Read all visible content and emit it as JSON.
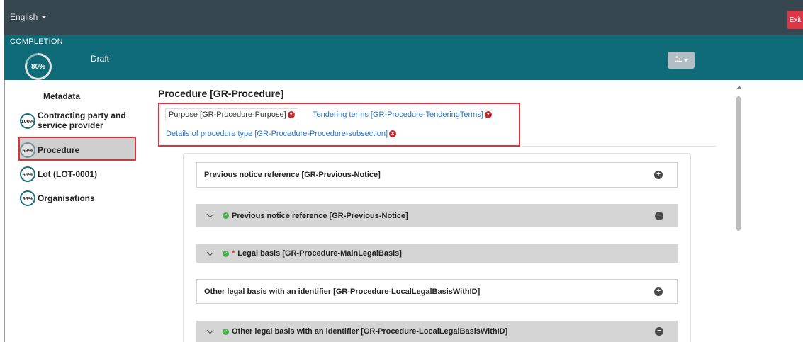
{
  "topbar": {
    "language": "English",
    "exit_label": "Exit"
  },
  "completion": {
    "title": "COMPLETION",
    "percent": "80%",
    "status": "Draft"
  },
  "sidebar": {
    "heading": "Metadata",
    "items": [
      {
        "pct": "100%",
        "label_line1": "Contracting party and",
        "label_line2": "service provider"
      },
      {
        "pct": "69%",
        "label": "Procedure"
      },
      {
        "pct": "65%",
        "label": "Lot (LOT-0001)"
      },
      {
        "pct": "95%",
        "label": "Organisations"
      }
    ]
  },
  "main": {
    "title": "Procedure [GR-Procedure]",
    "tabs": [
      {
        "label": "Purpose  [GR-Procedure-Purpose]"
      },
      {
        "label": "Tendering terms  [GR-Procedure-TenderingTerms]"
      },
      {
        "label": "Details of procedure type  [GR-Procedure-Procedure-subsection]"
      }
    ],
    "sections": [
      {
        "label": "Previous notice reference  [GR-Previous-Notice]"
      },
      {
        "label": "Previous notice reference  [GR-Previous-Notice]"
      },
      {
        "label": "Legal basis  [GR-Procedure-MainLegalBasis]",
        "required": "*"
      },
      {
        "label": "Other legal basis with an identifier  [GR-Procedure-LocalLegalBasisWithID]"
      },
      {
        "label": "Other legal basis with an identifier  [GR-Procedure-LocalLegalBasisWithID]"
      }
    ]
  },
  "colors": {
    "topbar": "#37474f",
    "completion_bar": "#0e6b77",
    "highlight": "#e0323b",
    "link": "#2574c9",
    "exit": "#dc3545"
  }
}
